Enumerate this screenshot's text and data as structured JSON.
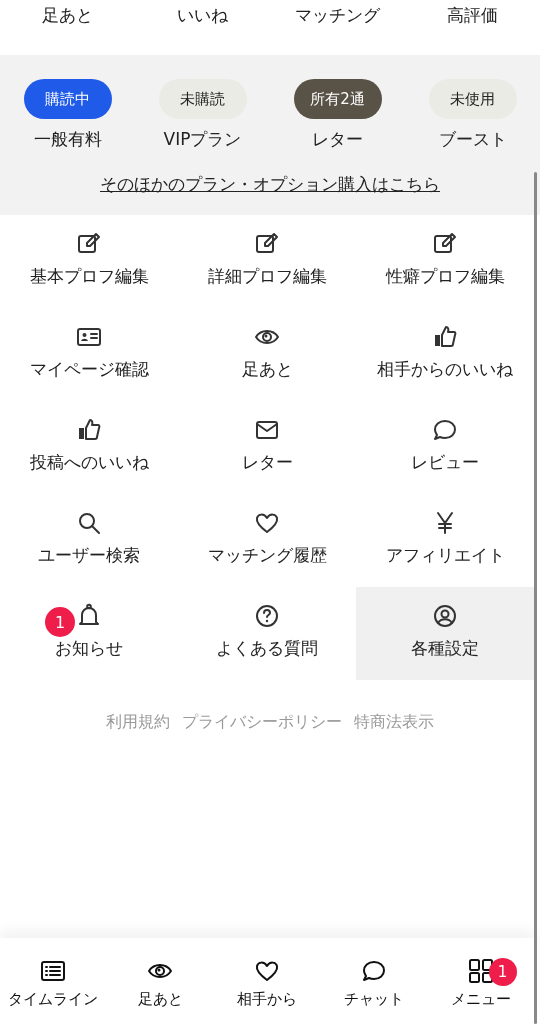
{
  "top_tabs": [
    {
      "label": "足あと"
    },
    {
      "label": "いいね"
    },
    {
      "label": "マッチング"
    },
    {
      "label": "高評価"
    }
  ],
  "plans": [
    {
      "status": "購読中",
      "kind": "active",
      "label": "一般有料"
    },
    {
      "status": "未購読",
      "kind": "inactive",
      "label": "VIPプラン"
    },
    {
      "status": "所有2通",
      "kind": "owned",
      "label": "レター"
    },
    {
      "status": "未使用",
      "kind": "inactive",
      "label": "ブースト"
    }
  ],
  "plans_link": "そのほかのプラン・オプション購入はこちら",
  "menu_items": [
    {
      "label": "基本プロフ編集",
      "selected": false
    },
    {
      "label": "詳細プロフ編集",
      "selected": false
    },
    {
      "label": "性癖プロフ編集",
      "selected": false
    },
    {
      "label": "マイページ確認",
      "selected": false
    },
    {
      "label": "足あと",
      "selected": false
    },
    {
      "label": "相手からのいいね",
      "selected": false
    },
    {
      "label": "投稿へのいいね",
      "selected": false
    },
    {
      "label": "レター",
      "selected": false
    },
    {
      "label": "レビュー",
      "selected": false
    },
    {
      "label": "ユーザー検索",
      "selected": false
    },
    {
      "label": "マッチング履歴",
      "selected": false
    },
    {
      "label": "アフィリエイト",
      "selected": false
    },
    {
      "label": "お知らせ",
      "selected": false,
      "badge": "1"
    },
    {
      "label": "よくある質問",
      "selected": false
    },
    {
      "label": "各種設定",
      "selected": true
    }
  ],
  "footer_links": [
    "利用規約",
    "プライバシーポリシー",
    "特商法表示"
  ],
  "bottom_nav": [
    {
      "label": "タイムライン"
    },
    {
      "label": "足あと"
    },
    {
      "label": "相手から"
    },
    {
      "label": "チャット"
    },
    {
      "label": "メニュー",
      "badge": "1"
    }
  ]
}
